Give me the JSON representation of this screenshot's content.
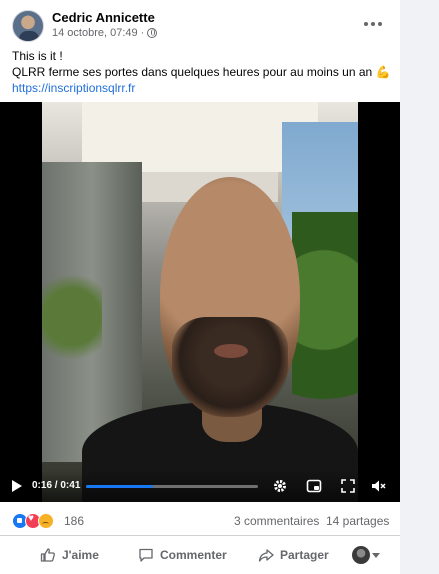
{
  "post": {
    "author": "Cedric Annicette",
    "date": "14 octobre, 07:49",
    "separator": "·",
    "text_line1": "This is it !",
    "text_line2": "QLRR ferme ses portes dans quelques heures pour au moins un an",
    "emoji": "💪",
    "link": "https://inscriptionsqlrr.fr"
  },
  "video": {
    "current_time": "0:16",
    "duration": "0:41",
    "time_separator": " / ",
    "progress_fraction": 0.39
  },
  "stats": {
    "reaction_count": "186",
    "comments": "3 commentaires",
    "shares": "14 partages"
  },
  "actions": {
    "like_label": "J'aime",
    "comment_label": "Commenter",
    "share_label": "Partager"
  },
  "colors": {
    "accent": "#1877f2",
    "link": "#216fdb",
    "secondary_text": "#65676b"
  },
  "icons": {
    "privacy": "globe-icon",
    "more": "more-options-icon",
    "play": "play-icon",
    "settings": "gear-icon",
    "pip": "picture-in-picture-icon",
    "fullscreen": "fullscreen-icon",
    "volume": "volume-muted-icon"
  }
}
